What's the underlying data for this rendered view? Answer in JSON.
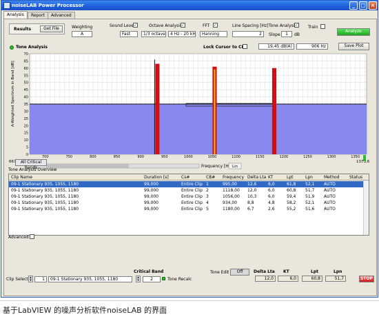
{
  "window": {
    "title": "noiseLAB Power Processor"
  },
  "tabs": [
    "Analysis",
    "Report",
    "Advanced"
  ],
  "toolbar": {
    "results_label": "Results",
    "get_file": "Get File",
    "weighting_label": "Weighting",
    "weighting_value": "A",
    "sound_level_label": "Sound Level",
    "sound_level_value": "Fast",
    "octave_label": "Octave Analysis",
    "octave_value1": "1/3 octave",
    "octave_value2": "4 Hz - 20 kHz",
    "fft_label": "FFT",
    "fft_value": "Hanning",
    "line_spacing_label": "Line Spacing [Hz]",
    "line_spacing_value": "2",
    "tone_label": "Tone Analysis",
    "slope_label": "Slope",
    "slope_value": "1",
    "slope_unit": "dB",
    "train_label": "Train",
    "analyze": "Analyze"
  },
  "chart_header": {
    "title": "Tone Analysis",
    "lock_label": "Lock Cursor to CB",
    "cursor_db": "19,45",
    "cursor_db_unit": "dB(A)",
    "cursor_hz": "906",
    "cursor_hz_unit": "Hz",
    "save_plot": "Save Plot"
  },
  "chart_data": {
    "type": "bar",
    "ylabel": "A-Weighted Spectrum in Band [dB]",
    "xlabel": "Frequency [Hz]",
    "xlim": [
      667.148,
      1373.6
    ],
    "ylim": [
      0,
      70
    ],
    "x_start_label": "667,148",
    "x_end_label": "1373,6",
    "x_ticks": [
      700,
      750,
      800,
      850,
      900,
      950,
      1000,
      1050,
      1100,
      1150,
      1200,
      1250,
      1300,
      1350
    ],
    "y_ticks": [
      0,
      5,
      10,
      15,
      20,
      25,
      30,
      35,
      40,
      45,
      50,
      55,
      60,
      65,
      70
    ],
    "noise_floor": 35,
    "tones": [
      {
        "freq": 935,
        "level": 63
      },
      {
        "freq": 1055,
        "level": 61
      },
      {
        "freq": 1180,
        "level": 60
      }
    ],
    "critical_band": {
      "x1": 995,
      "x2": 1180,
      "level": 34
    },
    "lin_button": "Lin",
    "colors": {
      "spectrum": "#8888ee",
      "tone": "#d01010",
      "highlight": "#e8c020"
    }
  },
  "critical_bands_btn": "All Critical Bands",
  "table": {
    "title": "Tone Analysis Overview",
    "columns": [
      "Clip Name",
      "Duration [s]",
      "Cs#",
      "CB#",
      "Frequency",
      "Delta Lta",
      "KT",
      "Lpt",
      "Lpn",
      "Method",
      "Status"
    ],
    "rows": [
      [
        "09-1 Stationary 935, 1055, 1180",
        "99,000",
        "Entire Clip",
        "1",
        "995,00",
        "12,6",
        "6,0",
        "61,8",
        "52,1",
        "AUTO",
        ""
      ],
      [
        "09-1 Stationary 935, 1055, 1180",
        "99,000",
        "Entire Clip",
        "2",
        "1118,00",
        "12,0",
        "6,0",
        "60,8",
        "51,7",
        "AUTO",
        ""
      ],
      [
        "09-1 Stationary 935, 1055, 1180",
        "99,000",
        "Entire Clip",
        "3",
        "1056,00",
        "10,3",
        "6,0",
        "59,4",
        "51,9",
        "AUTO",
        ""
      ],
      [
        "09-1 Stationary 935, 1055, 1180",
        "99,000",
        "Entire Clip",
        "4",
        "934,00",
        "8,8",
        "4,8",
        "58,2",
        "52,1",
        "AUTO",
        ""
      ],
      [
        "09-1 Stationary 935, 1055, 1180",
        "99,000",
        "Entire Clip",
        "5",
        "1180,00",
        "6,7",
        "2,6",
        "55,2",
        "51,6",
        "AUTO",
        ""
      ]
    ]
  },
  "advanced_label": "Advanced",
  "footer": {
    "clip_select_label": "Clip Select",
    "clip_index": "1",
    "clip_name": "09-1 Stationary 935, 1055, 1180",
    "critical_band_label": "Critical Band",
    "critical_band_value": "2",
    "tone_recalc": "Tone Recalc",
    "tone_edit_label": "Tone Edit",
    "tone_edit_value": "Off",
    "metric_labels": [
      "Delta Lta",
      "KT",
      "Lpt",
      "Lpn"
    ],
    "metric_values": [
      "12,0",
      "6,0",
      "60,8",
      "51,7"
    ],
    "stop": "STOP"
  },
  "caption": "基于LabVIEW 的噪声分析软件noiseLAB 的界面"
}
